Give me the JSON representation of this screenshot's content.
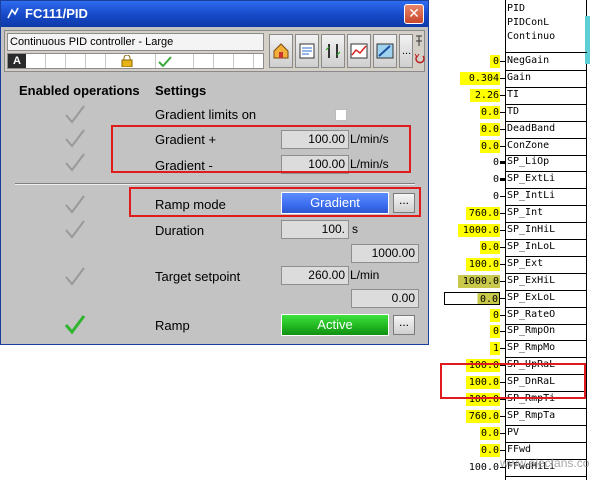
{
  "window": {
    "title": "FC111/PID",
    "close_glyph": "✕",
    "toolbar": {
      "title": "Continuous PID controller - Large",
      "status_letter": "A",
      "more_label": "...",
      "buttons": [
        "home-icon",
        "faceplate-view-icon",
        "limits-icon",
        "trend-icon",
        "preview-icon",
        "more-button",
        "pin-icon",
        "back-icon"
      ]
    }
  },
  "headers": {
    "left": "Enabled operations",
    "right": "Settings"
  },
  "settings": {
    "gradient_limits": {
      "label": "Gradient limits on"
    },
    "gradient_plus": {
      "label": "Gradient +",
      "value": "100.00",
      "unit": "L/min/s"
    },
    "gradient_minus": {
      "label": "Gradient -",
      "value": "100.00",
      "unit": "L/min/s"
    },
    "ramp_mode": {
      "label": "Ramp mode",
      "value": "Gradient",
      "more": "..."
    },
    "duration": {
      "label": "Duration",
      "value": "100.",
      "unit": "s",
      "extra": "1000.00"
    },
    "target_setpoint": {
      "label": "Target setpoint",
      "value": "260.00",
      "unit": "L/min",
      "extra": "0.00"
    },
    "ramp": {
      "label": "Ramp",
      "value": "Active",
      "more": "..."
    }
  },
  "colors": {
    "highlight_red": "#e01b1b",
    "ramp_mode_blue": "#3b6df0",
    "ramp_active_green": "#1fb41f",
    "pin_yellow": "#ffff00",
    "pin_olive": "#c8c84a",
    "check_gray": "#9a9a9a",
    "check_green": "#2fb52f"
  },
  "block": {
    "header_lines": [
      "PID",
      "PIDConL",
      "Continuo"
    ],
    "pins": [
      {
        "name": "NegGain",
        "value": "0"
      },
      {
        "name": "Gain",
        "value": "0.304"
      },
      {
        "name": "TI",
        "value": "2.26"
      },
      {
        "name": "TD",
        "value": "0.0"
      },
      {
        "name": "DeadBand",
        "value": "0.0"
      },
      {
        "name": "ConZone",
        "value": "0.0"
      },
      {
        "name": "SP_LiOp",
        "value": "0"
      },
      {
        "name": "SP_ExtLi",
        "value": "0"
      },
      {
        "name": "SP_IntLi",
        "value": "0"
      },
      {
        "name": "SP_Int",
        "value": "760.0"
      },
      {
        "name": "SP_InHiL",
        "value": "1000.0"
      },
      {
        "name": "SP_InLoL",
        "value": "0.0"
      },
      {
        "name": "SP_Ext",
        "value": "100.0"
      },
      {
        "name": "SP_ExHiL",
        "value": "1000.0"
      },
      {
        "name": "SP_ExLoL",
        "value": "0.0"
      },
      {
        "name": "SP_RateO",
        "value": "0"
      },
      {
        "name": "SP_RmpOn",
        "value": "0"
      },
      {
        "name": "SP_RmpMo",
        "value": "1"
      },
      {
        "name": "SP_UpRaL",
        "value": "100.0"
      },
      {
        "name": "SP_DnRaL",
        "value": "100.0"
      },
      {
        "name": "SP_RmpTi",
        "value": "100.0"
      },
      {
        "name": "SP_RmpTa",
        "value": "760.0"
      },
      {
        "name": "PV",
        "value": "0.0"
      },
      {
        "name": "FFwd",
        "value": "0.0"
      },
      {
        "name": "FFwdHiLi",
        "value": "100.0"
      }
    ],
    "watermark": "www.elecfans.com"
  }
}
